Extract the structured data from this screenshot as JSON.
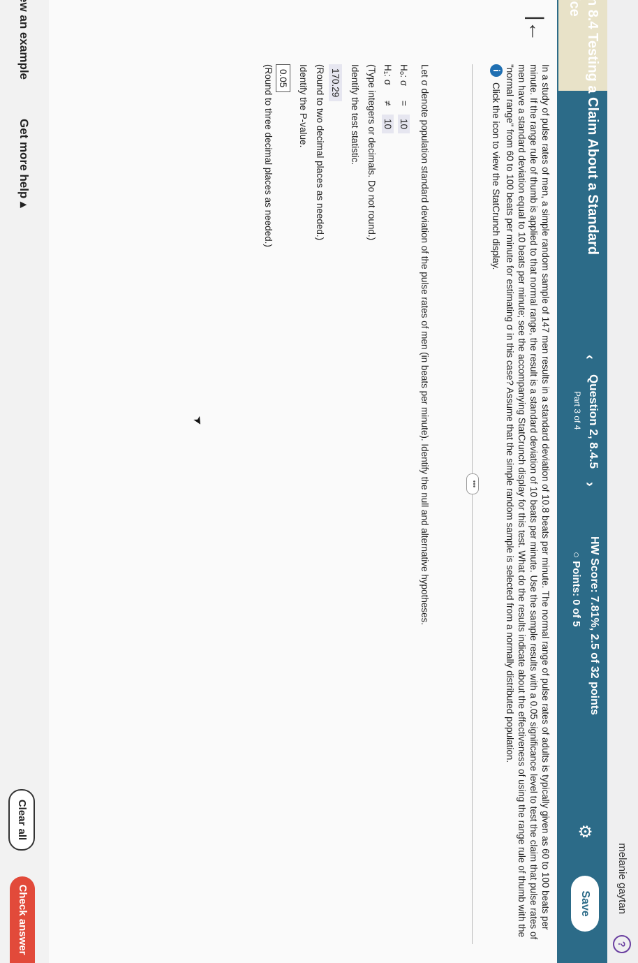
{
  "header": {
    "user_name": "melanie gaytan",
    "help_icon": "?"
  },
  "title_bar": {
    "section_title": "n 8.4 Testing a Claim About a Standard",
    "section_title_line2": "ice",
    "question_title": "Question 2, 8.4.5",
    "question_part": "Part 3 of 4",
    "hw_score": "HW Score: 7.81%, 2.5 of 32 points",
    "points": "Points: 0 of 5",
    "points_icon": "○",
    "save_label": "Save",
    "prev_icon": "‹",
    "next_icon": "›"
  },
  "question": {
    "back_icon": "|←",
    "text": "In a study of pulse rates of men, a simple random sample of 147 men results in a standard deviation of 10.8 beats per minute. The normal range of pulse rates of adults is typically given as 60 to 100 beats per minute. If the range rule of thumb is applied to that normal range, the result is a standard deviation of 10 beats per minute. Use the sample results with a 0.05 significance level to test the claim that pulse rates of men have a standard deviation equal to 10 beats per minute; see the accompanying StatCrunch display for this test. What do the results indicate about the effectiveness of using the range rule of thumb with the \"normal range\" from 60 to 100 beats per minute for estimating σ in this case? Assume that the simple random sample is selected from a normally distributed population.",
    "info_icon": "i",
    "info_text": "Click the icon to view the StatCrunch display.",
    "more_icon": "•••"
  },
  "work": {
    "prompt": "Let σ denote population standard deviation of the pulse rates of men (in beats per minute). Identify the null and alternative hypotheses.",
    "h0_label": "H₀: σ",
    "h0_op": "=",
    "h0_value": "10",
    "h1_label": "H₁: σ",
    "h1_op": "≠",
    "h1_value": "10",
    "hyp_note": "(Type integers or decimals. Do not round.)",
    "test_stat_prompt": "Identify the test statistic.",
    "test_stat_value": "170.29",
    "test_stat_note": "(Round to two decimal places as needed.)",
    "pvalue_prompt": "Identify the P-value.",
    "pvalue_value": "0.05",
    "pvalue_note": "(Round to three decimal places as needed.)"
  },
  "footer": {
    "view_example": "ew an example",
    "get_help": "Get more help ▴",
    "clear_all": "Clear all",
    "check_answer": "Check answer"
  }
}
